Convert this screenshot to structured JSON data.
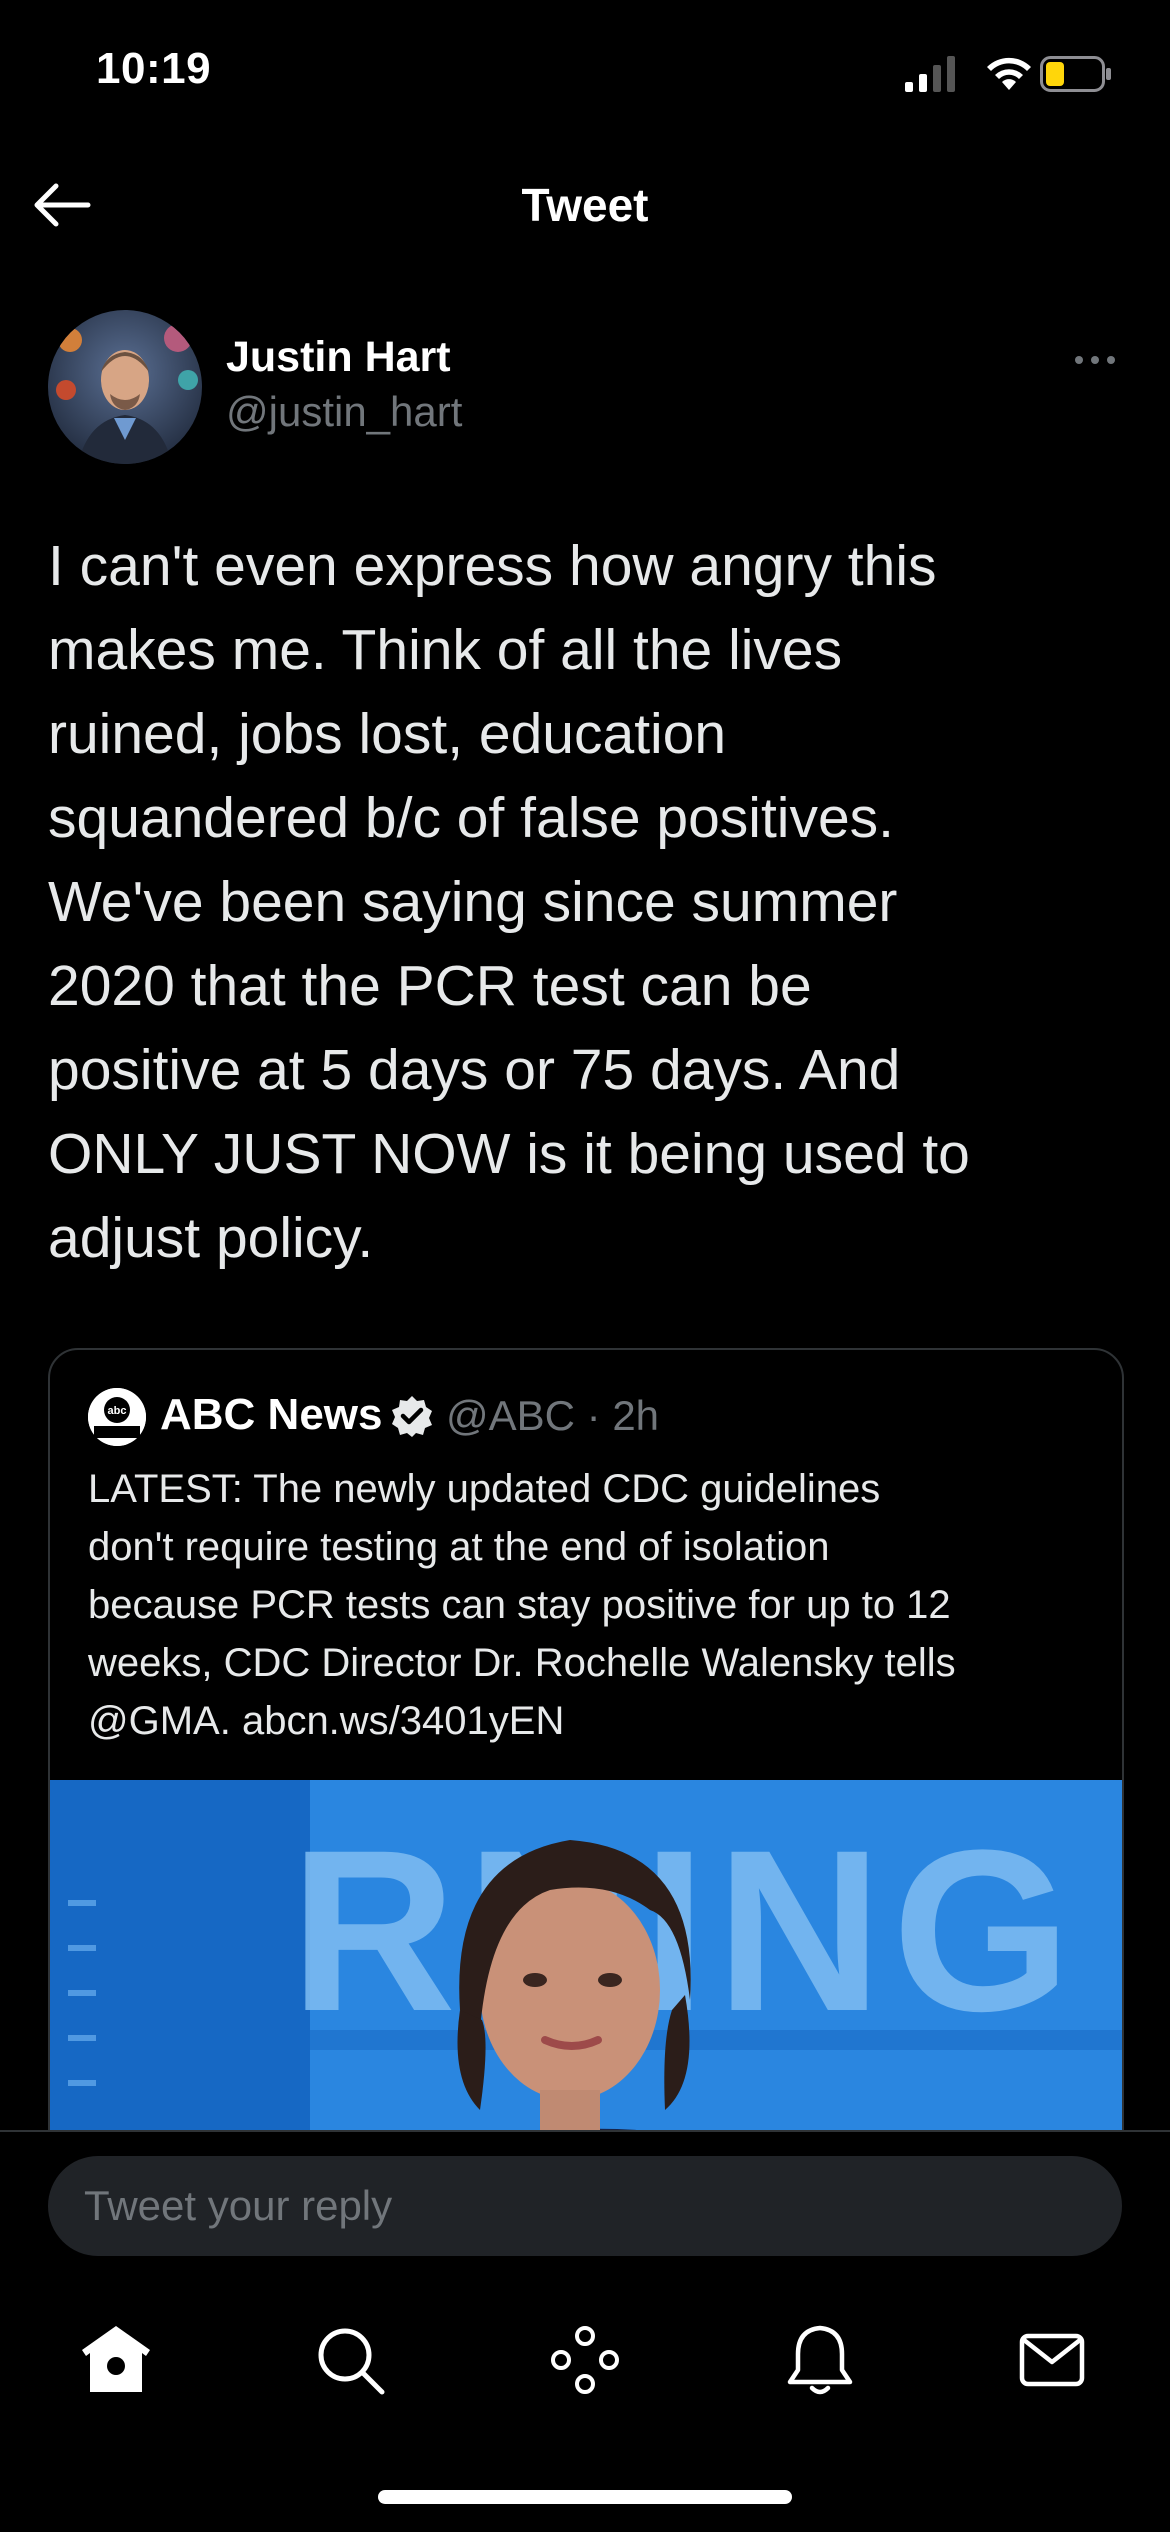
{
  "status_bar": {
    "time": "10:19"
  },
  "header": {
    "title": "Tweet"
  },
  "tweet": {
    "author_name": "Justin Hart",
    "author_handle": "@justin_hart",
    "text": "I can't even express how angry this\nmakes me. Think of all the lives\nruined, jobs lost, education\nsquandered b/c of false positives.\nWe've been saying since summer\n2020 that the PCR test can be\npositive at 5 days or 75 days. And\nONLY JUST NOW is it being used to\nadjust policy."
  },
  "quote": {
    "name": "ABC News",
    "handle_time": "@ABC · 2h",
    "logo_text": "abc",
    "text": "LATEST: The newly updated CDC guidelines\ndon't require testing at the end of isolation\nbecause PCR tests can stay positive for up to 12\nweeks, CDC Director Dr. Rochelle Walensky tells\n@GMA. abcn.ws/3401yEN",
    "media_background_text": "RNING"
  },
  "reply": {
    "placeholder": "Tweet your reply"
  },
  "tabs": [
    "home-icon",
    "search-icon",
    "spaces-icon",
    "notifications-icon",
    "messages-icon"
  ],
  "colors": {
    "background": "#000000",
    "text": "#e7e9ea",
    "secondary": "#71767b",
    "border": "#2f3336",
    "battery": "#ffd60a",
    "media_blue": "#1a76d2"
  }
}
